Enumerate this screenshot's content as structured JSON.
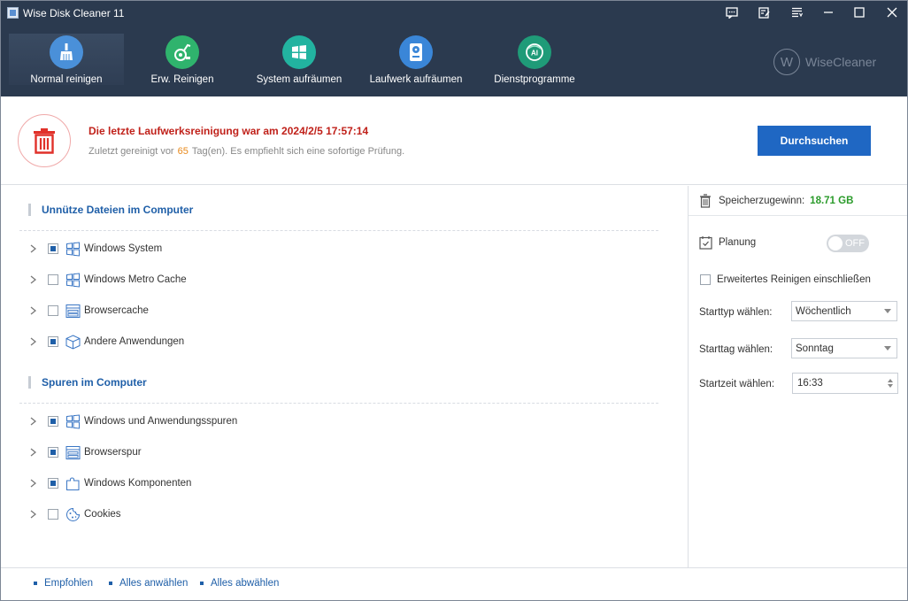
{
  "window": {
    "title": "Wise Disk Cleaner 11"
  },
  "nav": [
    {
      "label": "Normal reinigen",
      "icon": "broom-icon",
      "color": "#4a90d9"
    },
    {
      "label": "Erw. Reinigen",
      "icon": "vacuum-icon",
      "color": "#2fb36d"
    },
    {
      "label": "System aufräumen",
      "icon": "windows-icon",
      "color": "#22b3a0"
    },
    {
      "label": "Laufwerk aufräumen",
      "icon": "drive-icon",
      "color": "#3a86d8"
    },
    {
      "label": "Dienstprogramme",
      "icon": "ai-icon",
      "color": "#1f9b78"
    }
  ],
  "brand": {
    "letter": "W",
    "name": "WiseCleaner"
  },
  "info": {
    "last_clean": "Die letzte Laufwerksreinigung war am 2024/2/5 17:57:14",
    "sub_prefix": "Zuletzt gereinigt vor",
    "days": "65",
    "sub_suffix": "Tag(en). Es empfiehlt sich eine sofortige Prüfung.",
    "scan_button": "Durchsuchen"
  },
  "sections": [
    {
      "title": "Unnütze Dateien im Computer",
      "items": [
        {
          "label": "Windows System",
          "checked": true,
          "icon": "windows-grid-icon"
        },
        {
          "label": "Windows Metro Cache",
          "checked": false,
          "icon": "windows-grid-icon"
        },
        {
          "label": "Browsercache",
          "checked": false,
          "icon": "browser-icon"
        },
        {
          "label": "Andere Anwendungen",
          "checked": true,
          "icon": "package-icon"
        }
      ]
    },
    {
      "title": "Spuren im Computer",
      "items": [
        {
          "label": "Windows und Anwendungsspuren",
          "checked": true,
          "icon": "windows-grid-icon"
        },
        {
          "label": "Browserspur",
          "checked": true,
          "icon": "browser-icon"
        },
        {
          "label": "Windows Komponenten",
          "checked": true,
          "icon": "puzzle-icon"
        },
        {
          "label": "Cookies",
          "checked": false,
          "icon": "cookie-icon"
        }
      ]
    }
  ],
  "panel": {
    "gain_label": "Speicherzugewinn:",
    "gain_value": "18.71 GB",
    "plan_label": "Planung",
    "toggle_text": "OFF",
    "extended_label": "Erweitertes Reinigen einschließen",
    "start_type_label": "Starttyp wählen:",
    "start_type_value": "Wöchentlich",
    "start_day_label": "Starttag wählen:",
    "start_day_value": "Sonntag",
    "start_time_label": "Startzeit wählen:",
    "start_time_value": "16:33"
  },
  "footer": {
    "recommended": "Empfohlen",
    "select_all": "Alles anwählen",
    "deselect_all": "Alles abwählen"
  }
}
